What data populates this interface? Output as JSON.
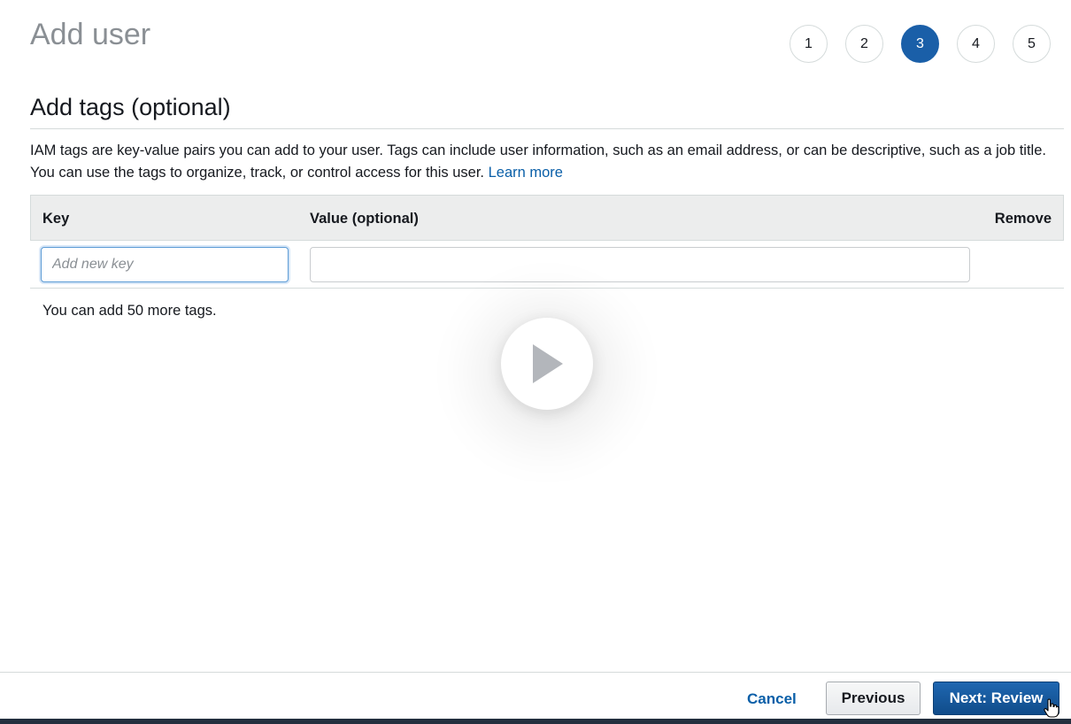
{
  "page": {
    "title": "Add user"
  },
  "steps": [
    {
      "label": "1",
      "active": false
    },
    {
      "label": "2",
      "active": false
    },
    {
      "label": "3",
      "active": true
    },
    {
      "label": "4",
      "active": false
    },
    {
      "label": "5",
      "active": false
    }
  ],
  "section": {
    "title": "Add tags (optional)",
    "description": "IAM tags are key-value pairs you can add to your user. Tags can include user information, such as an email address, or can be descriptive, such as a job title. You can use the tags to organize, track, or control access for this user.",
    "learn_more": "Learn more"
  },
  "table": {
    "columns": {
      "key": "Key",
      "value": "Value (optional)",
      "remove": "Remove"
    },
    "row": {
      "key_value": "",
      "key_placeholder": "Add new key",
      "value_value": "",
      "value_placeholder": ""
    },
    "remaining_text": "You can add 50 more tags."
  },
  "overlay": {
    "icon": "play-icon"
  },
  "footer": {
    "cancel_label": "Cancel",
    "previous_label": "Previous",
    "next_label": "Next: Review"
  },
  "colors": {
    "accent": "#1a5fa8",
    "link": "#0a5fa8",
    "primary_button": "#104c8a",
    "header_bg": "#eceded",
    "bottom_bar": "#232f3e"
  }
}
